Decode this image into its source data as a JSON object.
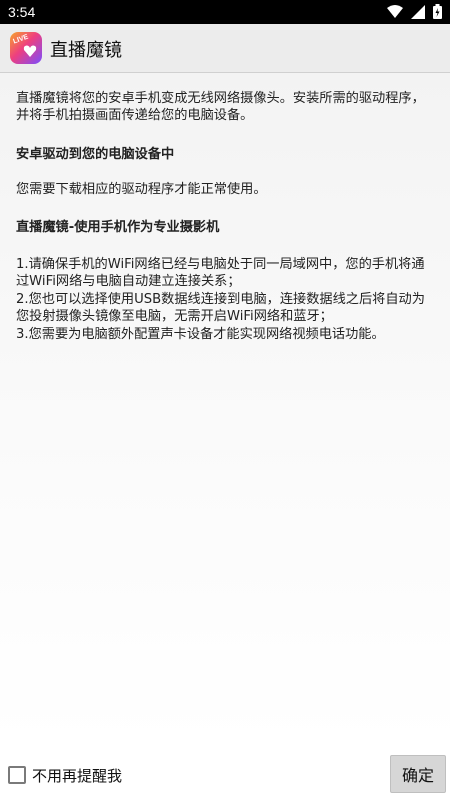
{
  "status_bar": {
    "time": "3:54",
    "icons": [
      "wifi-icon",
      "signal-icon",
      "battery-icon"
    ]
  },
  "app_bar": {
    "logo_icon": "live-heart-logo",
    "title": "直播魔镜"
  },
  "content": {
    "intro": "直播魔镜将您的安卓手机变成无线网络摄像头。安装所需的驱动程序，并将手机拍摄画面传递给您的电脑设备。",
    "section1_heading": "安卓驱动到您的电脑设备中",
    "section1_text": "您需要下载相应的驱动程序才能正常使用。",
    "section2_heading": "直播魔镜-使用手机作为专业摄影机",
    "steps": [
      "1.请确保手机的WiFi网络已经与电脑处于同一局域网中，您的手机将通过WiFi网络与电脑自动建立连接关系；",
      "2.您也可以选择使用USB数据线连接到电脑，连接数据线之后将自动为您投射摄像头镜像至电脑，无需开启WiFi网络和蓝牙；",
      "3.您需要为电脑额外配置声卡设备才能实现网络视频电话功能。"
    ]
  },
  "footer": {
    "checkbox_label": "不用再提醒我",
    "checkbox_checked": false,
    "confirm_label": "确定"
  },
  "colors": {
    "status_bar": "#000000",
    "app_bar": "#ececec",
    "button": "#d6d6d6"
  }
}
